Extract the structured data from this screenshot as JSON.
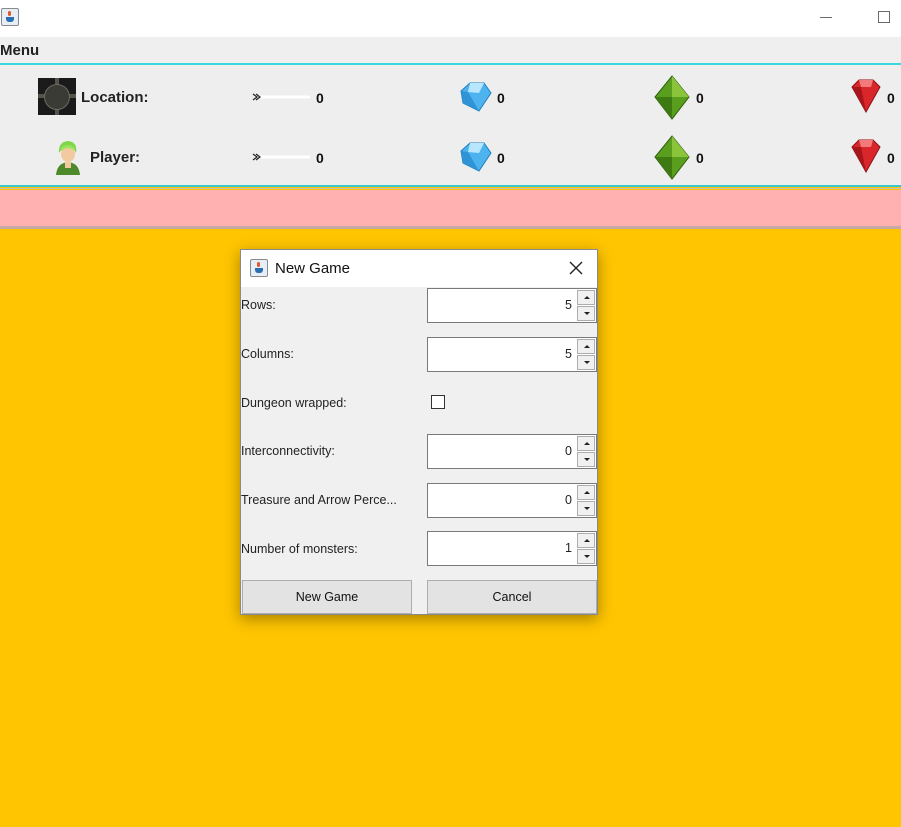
{
  "window": {
    "icon": "java-cup-icon",
    "controls": [
      "minimize-icon",
      "maximize-icon"
    ]
  },
  "menubar": {
    "menu_label": "Menu"
  },
  "status": {
    "location": {
      "label": "Location:",
      "icon": "dungeon-tile-icon",
      "arrows": "0",
      "blue": "0",
      "green": "0",
      "red": "0"
    },
    "player": {
      "label": "Player:",
      "icon": "player-avatar-icon",
      "arrows": "0",
      "blue": "0",
      "green": "0",
      "red": "0"
    }
  },
  "colors": {
    "background": "#ffc500",
    "message_bar": "#ffb0b0",
    "accent_line": "#39d7e0",
    "gem_blue": "#4db3ee",
    "gem_green": "#5a9e1e",
    "gem_red": "#d9262b"
  },
  "dialog": {
    "title": "New Game",
    "fields": {
      "rows": {
        "label": "Rows:",
        "value": "5"
      },
      "columns": {
        "label": "Columns:",
        "value": "5"
      },
      "wrapped": {
        "label": "Dungeon wrapped:"
      },
      "interconnectivity": {
        "label": "Interconnectivity:",
        "value": "0"
      },
      "treasure": {
        "label": "Treasure and Arrow Perce...",
        "value": "0"
      },
      "monsters": {
        "label": "Number of monsters:",
        "value": "1"
      }
    },
    "buttons": {
      "ok": "New Game",
      "cancel": "Cancel"
    }
  }
}
